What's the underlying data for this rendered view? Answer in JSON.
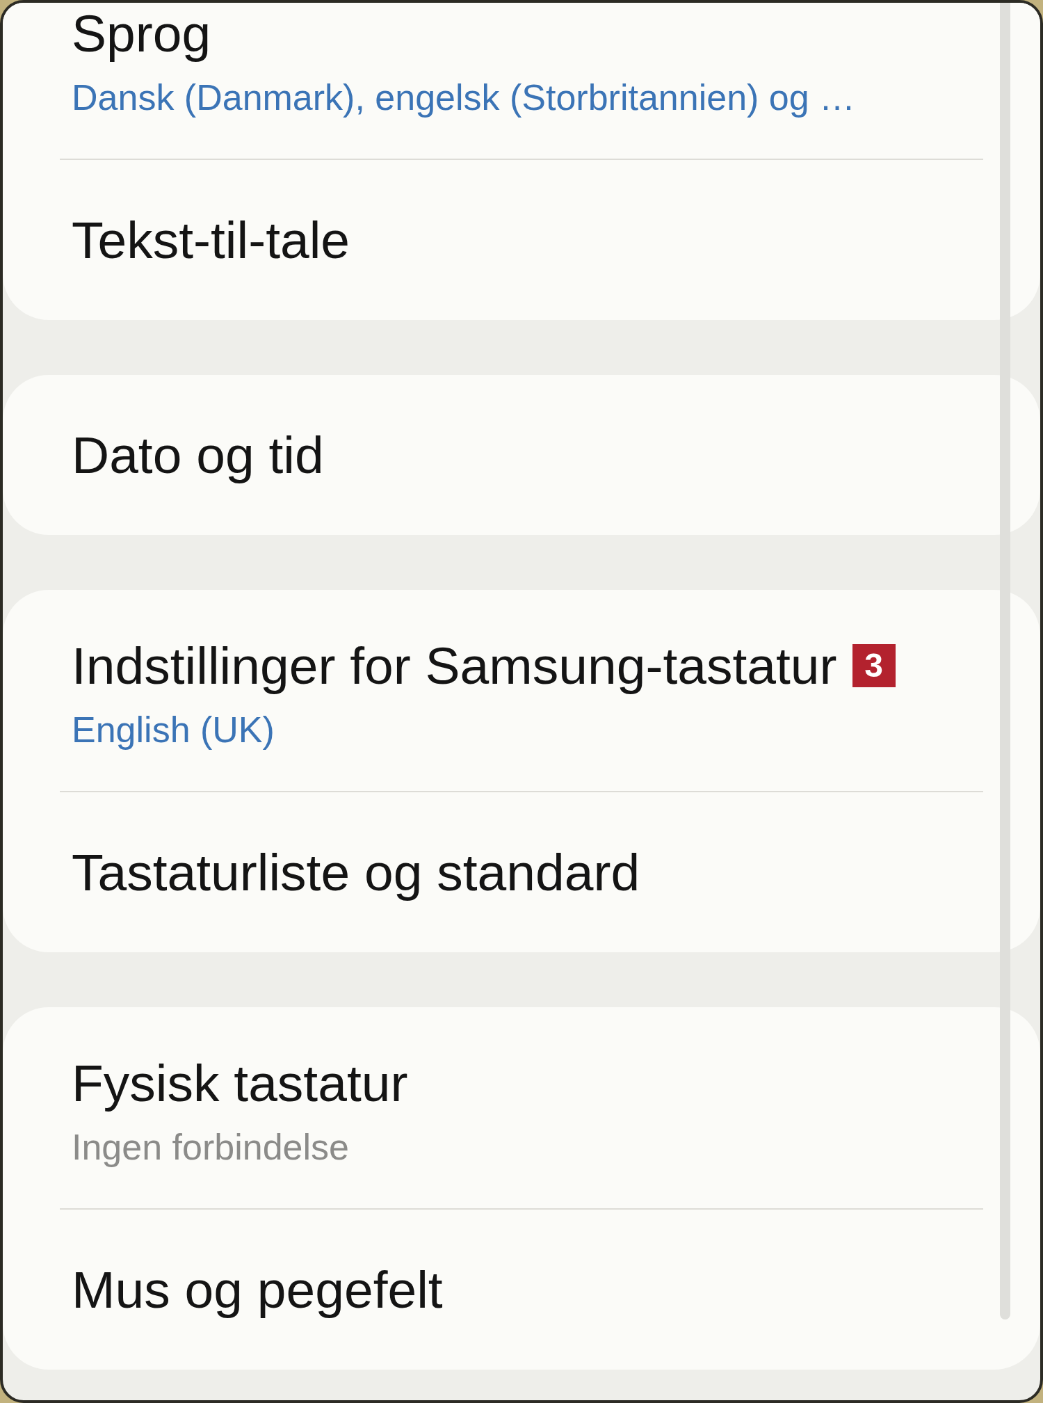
{
  "cards": [
    {
      "items": [
        {
          "title": "Sprog",
          "subtitle": {
            "text": "Dansk (Danmark), engelsk (Storbritannien) og …",
            "kind": "value"
          }
        },
        {
          "title": "Tekst-til-tale"
        }
      ]
    },
    {
      "items": [
        {
          "title": "Dato og tid"
        }
      ]
    },
    {
      "items": [
        {
          "title": "Indstillinger for Samsung-tastatur",
          "badge": "3",
          "subtitle": {
            "text": "English (UK)",
            "kind": "value"
          }
        },
        {
          "title": "Tastaturliste og standard"
        }
      ]
    },
    {
      "items": [
        {
          "title": "Fysisk tastatur",
          "subtitle": {
            "text": "Ingen forbindelse",
            "kind": "status"
          }
        },
        {
          "title": "Mus og pegefelt"
        }
      ]
    }
  ]
}
